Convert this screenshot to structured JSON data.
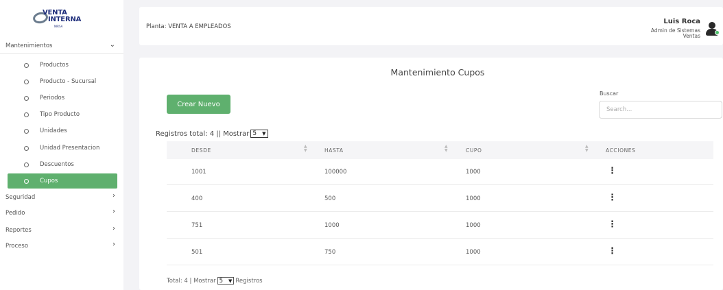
{
  "logo": {
    "line1": "VENTA",
    "line2": "INTERNA",
    "line3": "NIRSA"
  },
  "sidebar": {
    "section_mantenimientos": "Mantenimientos",
    "items": [
      {
        "label": "Productos"
      },
      {
        "label": "Producto - Sucursal"
      },
      {
        "label": "Periodos"
      },
      {
        "label": "Tipo Producto"
      },
      {
        "label": "Unidades"
      },
      {
        "label": "Unidad Presentacion"
      },
      {
        "label": "Descuentos"
      },
      {
        "label": "Cupos",
        "active": true
      }
    ],
    "sections": [
      {
        "label": "Seguridad"
      },
      {
        "label": "Pedido"
      },
      {
        "label": "Reportes"
      },
      {
        "label": "Proceso"
      }
    ]
  },
  "topbar": {
    "planta": "Planta: VENTA A EMPLEADOS",
    "user_name": "Luis Roca",
    "user_role": "Admin de Sistemas",
    "user_dept": "Ventas"
  },
  "main": {
    "title": "Mantenimiento Cupos",
    "create_button": "Crear Nuevo",
    "search_label": "Buscar",
    "search_placeholder": "Search...",
    "registros_text": "Registros total: 4 || Mostrar",
    "page_size": "5",
    "columns": [
      "DESDE",
      "HASTA",
      "CUPO",
      "ACCIONES"
    ],
    "rows": [
      {
        "desde": "1001",
        "hasta": "100000",
        "cupo": "1000"
      },
      {
        "desde": "400",
        "hasta": "500",
        "cupo": "1000"
      },
      {
        "desde": "751",
        "hasta": "1000",
        "cupo": "1000"
      },
      {
        "desde": "501",
        "hasta": "750",
        "cupo": "1000"
      }
    ],
    "actions_glyph": "⋮",
    "footer_total": "Total: 4 | Mostrar",
    "footer_page_size": "5",
    "footer_registros": "Registros"
  },
  "colors": {
    "accent_green": "#5fb06e",
    "logo_blue": "#1d2c7a"
  }
}
